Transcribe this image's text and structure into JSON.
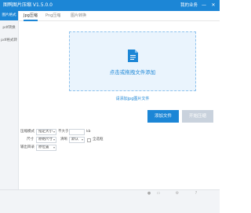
{
  "window": {
    "title": "图鸭图片压缩 V1.5.0.0",
    "header_link": "我的业务",
    "controls": {
      "minimize": "—",
      "close": "✕"
    }
  },
  "sidebar": {
    "items": [
      {
        "label": "图片格式",
        "active": true
      },
      {
        "label": "pdf转换",
        "active": false
      },
      {
        "label": "pdf格式转",
        "active": false
      }
    ]
  },
  "tabs": [
    {
      "label": "Jpg压缩",
      "active": true
    },
    {
      "label": "Png压缩",
      "active": false
    },
    {
      "label": "图片转换",
      "active": false
    }
  ],
  "dropzone": {
    "text": "点击或拖拽文件添加",
    "icon": "file-icon"
  },
  "note": "请添加jpg图片文件",
  "buttons": {
    "add": "添加文件",
    "start": "开始压缩"
  },
  "settings": {
    "compress_mode_label": "压缩模式",
    "compress_mode_value": "指定大小",
    "size_prefix": "不大于",
    "size_value": "",
    "size_unit": "kb",
    "size_label": "尺寸",
    "size_select_value": "原始尺寸",
    "quality_label": "清晰",
    "quality_value": "默认",
    "checkbox_label": "全选框",
    "output_label": "输出目录",
    "output_value": "原位置"
  },
  "colors": {
    "accent": "#1c86d6",
    "dropzone_bg": "#eaf4fd",
    "disabled_button": "#c9d2dd"
  }
}
